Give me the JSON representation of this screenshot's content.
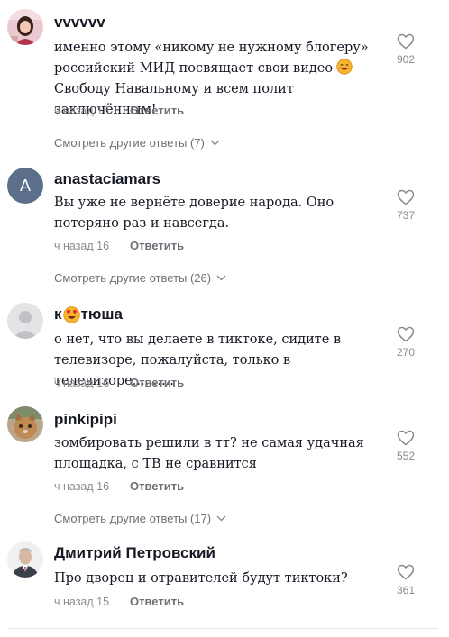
{
  "comments": [
    {
      "username": "vvvvvv",
      "text_before": "именно этому «никому не нужному блогеру» российский МИД посвящает свои видео",
      "text_after": " Свободу Навальному и всем полит заключённым!",
      "time": "ч назад 16",
      "reply_label": "Ответить",
      "likes": "902",
      "more_replies": "Смотреть другие ответы (7)"
    },
    {
      "username": "anastaciamars",
      "avatar_letter": "A",
      "text": "Вы уже не вернёте доверие народа. Оно потеряно раз и навсегда.",
      "time": "ч назад 16",
      "reply_label": "Ответить",
      "likes": "737",
      "more_replies": "Смотреть другие ответы (26)"
    },
    {
      "username_prefix": "к",
      "username_suffix": "тюша",
      "text": "о нет, что вы делаете в тиктоке, сидите в телевизоре, пожалуйста, только в телевизоре..........",
      "time": "ч назад 16",
      "reply_label": "Ответить",
      "likes": "270"
    },
    {
      "username": "pinkipipi",
      "text": "зомбировать решили в тт? не самая удачная площадка, с ТВ не сравнится",
      "time": "ч назад 16",
      "reply_label": "Ответить",
      "likes": "552",
      "more_replies": "Смотреть другие ответы (17)"
    },
    {
      "username": "Дмитрий Петровский",
      "text": "Про дворец и отравителей будут тиктоки?",
      "time": "ч назад 15",
      "reply_label": "Ответить",
      "likes": "361"
    }
  ],
  "colors": {
    "text": "#161823",
    "muted": "#8a8b91",
    "reply": "#6f7077",
    "avatar_letter_bg": "#5b6f8a"
  },
  "icons": {
    "like": "heart-outline-icon",
    "expand": "chevron-down-icon",
    "emoji_smile": "smiling-face-emoji",
    "emoji_heart_eyes": "heart-eyes-emoji"
  }
}
